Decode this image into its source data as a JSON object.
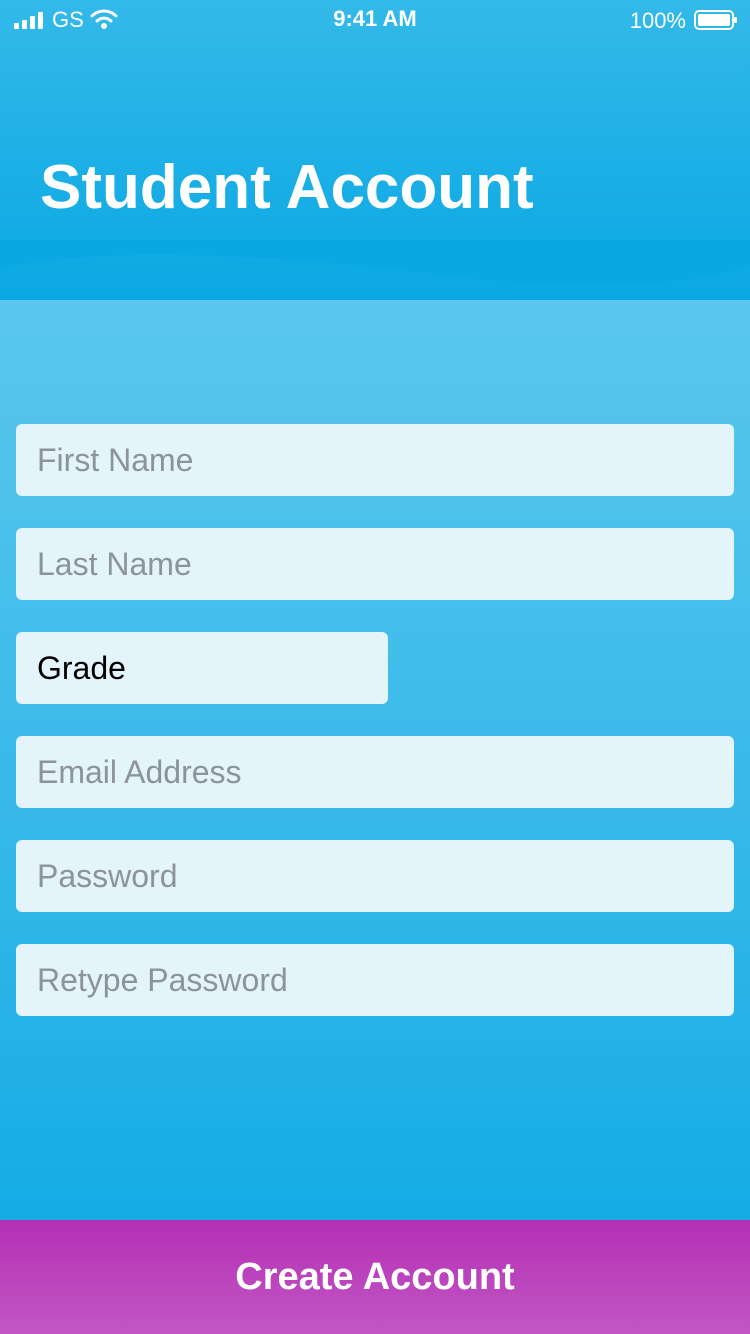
{
  "status_bar": {
    "carrier": "GS",
    "time": "9:41 AM",
    "battery_percent": "100%",
    "signal_icon": "cellular-signal-icon",
    "wifi_icon": "wifi-icon",
    "battery_icon": "battery-icon"
  },
  "header": {
    "title": "Student Account"
  },
  "form": {
    "first_name": {
      "placeholder": "First Name",
      "value": ""
    },
    "last_name": {
      "placeholder": "Last Name",
      "value": ""
    },
    "grade": {
      "selected": "Grade"
    },
    "email": {
      "placeholder": "Email Address",
      "value": ""
    },
    "password": {
      "placeholder": "Password",
      "value": ""
    },
    "retype_password": {
      "placeholder": "Retype Password",
      "value": ""
    }
  },
  "actions": {
    "create_account_label": "Create Account"
  },
  "colors": {
    "header_blue": "#0aa8e3",
    "background_light_blue": "#6dcdf0",
    "field_background": "#e3f4fb",
    "button_purple": "#b42fb5"
  }
}
